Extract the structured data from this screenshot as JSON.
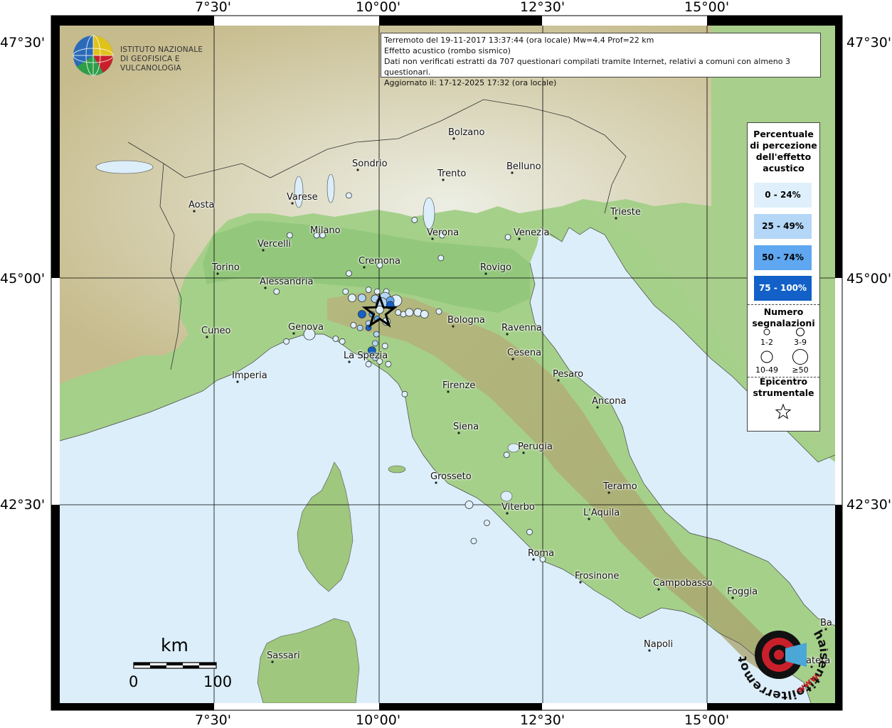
{
  "info": {
    "line1": "Terremoto del 19-11-2017 13:37:44 (ora locale) Mw=4.4 Prof=22 km",
    "line2": "Effetto acustico (rombo sismico)",
    "line3": "Dati non verificati estratti da 707 questionari compilati tramite Internet, relativi a comuni con almeno 3 questionari.",
    "line4": "Aggiornato il: 17-12-2025 17:32 (ora locale)"
  },
  "logo": {
    "line1": "ISTITUTO NAZIONALE",
    "line2": "DI GEOFISICA E VULCANOLOGIA"
  },
  "axes": {
    "top": [
      "7°30'",
      "10°00'",
      "12°30'",
      "15°00'"
    ],
    "bottom": [
      "7°30'",
      "10°00'",
      "12°30'",
      "15°00'"
    ],
    "left": [
      "47°30'",
      "45°00'",
      "42°30'"
    ],
    "right": [
      "47°30'",
      "45°00'",
      "42°30'"
    ]
  },
  "legend": {
    "title": [
      "Percentuale",
      "di percezione",
      "dell'effetto",
      "acustico"
    ],
    "classes": [
      {
        "label": "0 - 24%",
        "color": "#dff0fc"
      },
      {
        "label": "25 - 49%",
        "color": "#b4d6f7"
      },
      {
        "label": "50 - 74%",
        "color": "#5fa7f0"
      },
      {
        "label": "75 - 100%",
        "color": "#1260c8"
      }
    ],
    "count_title": [
      "Numero",
      "segnalazioni"
    ],
    "counts": [
      "1-2",
      "3-9",
      "10-49",
      "≥50"
    ],
    "epi_title": [
      "Epicentro",
      "strumentale"
    ]
  },
  "cities": [
    {
      "name": "Bolzano"
    },
    {
      "name": "Sondrio"
    },
    {
      "name": "Trento"
    },
    {
      "name": "Belluno"
    },
    {
      "name": "Varese"
    },
    {
      "name": "Aosta"
    },
    {
      "name": "Trieste"
    },
    {
      "name": "Milano"
    },
    {
      "name": "Verona"
    },
    {
      "name": "Venezia"
    },
    {
      "name": "Vercelli"
    },
    {
      "name": "Cremona"
    },
    {
      "name": "Torino"
    },
    {
      "name": "Rovigo"
    },
    {
      "name": "Alessandria"
    },
    {
      "name": "Bologna"
    },
    {
      "name": "Cuneo"
    },
    {
      "name": "Genova"
    },
    {
      "name": "Ravenna"
    },
    {
      "name": "Cesena"
    },
    {
      "name": "La Spezia"
    },
    {
      "name": "Pesaro"
    },
    {
      "name": "Imperia"
    },
    {
      "name": "Firenze"
    },
    {
      "name": "Ancona"
    },
    {
      "name": "Siena"
    },
    {
      "name": "Perugia"
    },
    {
      "name": "Grosseto"
    },
    {
      "name": "Teramo"
    },
    {
      "name": "Viterbo"
    },
    {
      "name": "L'Aquila"
    },
    {
      "name": "Roma"
    },
    {
      "name": "Frosinone"
    },
    {
      "name": "Campobasso"
    },
    {
      "name": "Foggia"
    },
    {
      "name": "Sassari"
    },
    {
      "name": "Napoli"
    },
    {
      "name": "Ba"
    },
    {
      "name": "atera"
    }
  ],
  "scale": {
    "unit": "km",
    "min": "0",
    "max": "100"
  },
  "watermark": {
    "text": "haisentitoilterremoto.it",
    "url_text": "www."
  },
  "colors": {
    "sea": "#dbeefa",
    "lowland": "#9fcf83",
    "hill": "#c7b98a",
    "mountain": "#e6e2da",
    "class1": "#dff0fc",
    "class2": "#b4d6f7",
    "class3": "#5fa7f0",
    "class4": "#1260c8"
  },
  "observations": [
    {
      "lon": 9.55,
      "lat": 45.91,
      "cls": 1,
      "n": 1
    },
    {
      "lon": 9.06,
      "lat": 45.47,
      "cls": 1,
      "n": 2
    },
    {
      "lon": 9.15,
      "lat": 45.47,
      "cls": 1,
      "n": 2
    },
    {
      "lon": 8.65,
      "lat": 45.47,
      "cls": 1,
      "n": 1
    },
    {
      "lon": 10.97,
      "lat": 45.47,
      "cls": 1,
      "n": 2
    },
    {
      "lon": 10.55,
      "lat": 45.64,
      "cls": 1,
      "n": 1
    },
    {
      "lon": 11.97,
      "lat": 45.45,
      "cls": 1,
      "n": 2
    },
    {
      "lon": 10.95,
      "lat": 45.22,
      "cls": 1,
      "n": 1
    },
    {
      "lon": 9.55,
      "lat": 45.05,
      "cls": 1,
      "n": 1
    },
    {
      "lon": 10.02,
      "lat": 45.14,
      "cls": 1,
      "n": 1
    },
    {
      "lon": 9.5,
      "lat": 44.85,
      "cls": 1,
      "n": 2
    },
    {
      "lon": 9.85,
      "lat": 44.87,
      "cls": 1,
      "n": 2
    },
    {
      "lon": 9.98,
      "lat": 44.85,
      "cls": 1,
      "n": 2
    },
    {
      "lon": 10.12,
      "lat": 44.85,
      "cls": 1,
      "n": 1
    },
    {
      "lon": 9.6,
      "lat": 44.78,
      "cls": 1,
      "n": 3
    },
    {
      "lon": 9.75,
      "lat": 44.78,
      "cls": 2,
      "n": 3
    },
    {
      "lon": 9.95,
      "lat": 44.77,
      "cls": 2,
      "n": 5
    },
    {
      "lon": 10.1,
      "lat": 44.78,
      "cls": 2,
      "n": 12
    },
    {
      "lon": 10.27,
      "lat": 44.75,
      "cls": 1,
      "n": 15
    },
    {
      "lon": 10.05,
      "lat": 44.72,
      "cls": 2,
      "n": 15
    },
    {
      "lon": 10.18,
      "lat": 44.75,
      "cls": 3,
      "n": 4
    },
    {
      "lon": 10.18,
      "lat": 44.7,
      "cls": 4,
      "n": 4
    },
    {
      "lon": 10.02,
      "lat": 44.65,
      "cls": 1,
      "n": 3
    },
    {
      "lon": 10.3,
      "lat": 44.62,
      "cls": 1,
      "n": 2
    },
    {
      "lon": 10.38,
      "lat": 44.6,
      "cls": 1,
      "n": 1
    },
    {
      "lon": 10.47,
      "lat": 44.62,
      "cls": 1,
      "n": 3
    },
    {
      "lon": 10.6,
      "lat": 44.62,
      "cls": 1,
      "n": 6
    },
    {
      "lon": 10.7,
      "lat": 44.6,
      "cls": 1,
      "n": 3
    },
    {
      "lon": 10.92,
      "lat": 44.63,
      "cls": 1,
      "n": 1
    },
    {
      "lon": 9.9,
      "lat": 44.6,
      "cls": 3,
      "n": 2
    },
    {
      "lon": 9.75,
      "lat": 44.6,
      "cls": 4,
      "n": 3
    },
    {
      "lon": 9.98,
      "lat": 44.55,
      "cls": 3,
      "n": 2
    },
    {
      "lon": 9.85,
      "lat": 44.5,
      "cls": 2,
      "n": 2
    },
    {
      "lon": 10.12,
      "lat": 44.52,
      "cls": 1,
      "n": 3
    },
    {
      "lon": 9.72,
      "lat": 44.45,
      "cls": 2,
      "n": 2
    },
    {
      "lon": 9.85,
      "lat": 44.45,
      "cls": 4,
      "n": 2
    },
    {
      "lon": 9.62,
      "lat": 44.48,
      "cls": 1,
      "n": 2
    },
    {
      "lon": 9.97,
      "lat": 44.38,
      "cls": 2,
      "n": 2
    },
    {
      "lon": 9.95,
      "lat": 44.28,
      "cls": 2,
      "n": 2
    },
    {
      "lon": 9.9,
      "lat": 44.2,
      "cls": 4,
      "n": 3
    },
    {
      "lon": 10.1,
      "lat": 44.25,
      "cls": 1,
      "n": 2
    },
    {
      "lon": 9.8,
      "lat": 44.15,
      "cls": 2,
      "n": 2
    },
    {
      "lon": 9.95,
      "lat": 44.12,
      "cls": 2,
      "n": 2
    },
    {
      "lon": 10.02,
      "lat": 44.08,
      "cls": 1,
      "n": 2
    },
    {
      "lon": 10.15,
      "lat": 44.05,
      "cls": 1,
      "n": 2
    },
    {
      "lon": 9.85,
      "lat": 44.05,
      "cls": 1,
      "n": 2
    },
    {
      "lon": 9.45,
      "lat": 44.3,
      "cls": 1,
      "n": 1
    },
    {
      "lon": 8.95,
      "lat": 44.38,
      "cls": 1,
      "n": 15
    },
    {
      "lon": 9.35,
      "lat": 44.33,
      "cls": 1,
      "n": 2
    },
    {
      "lon": 8.6,
      "lat": 44.3,
      "cls": 1,
      "n": 1
    },
    {
      "lon": 8.45,
      "lat": 44.85,
      "cls": 1,
      "n": 2
    },
    {
      "lon": 10.4,
      "lat": 43.72,
      "cls": 1,
      "n": 2
    },
    {
      "lon": 11.95,
      "lat": 43.05,
      "cls": 1,
      "n": 2
    },
    {
      "lon": 11.38,
      "lat": 42.5,
      "cls": 1,
      "n": 3
    },
    {
      "lon": 11.45,
      "lat": 42.1,
      "cls": 1,
      "n": 1
    },
    {
      "lon": 12.3,
      "lat": 42.2,
      "cls": 1,
      "n": 1
    },
    {
      "lon": 12.5,
      "lat": 41.9,
      "cls": 1,
      "n": 2
    },
    {
      "lon": 11.65,
      "lat": 42.3,
      "cls": 1,
      "n": 1
    }
  ],
  "epicenter": {
    "lon": 10.02,
    "lat": 44.62
  }
}
